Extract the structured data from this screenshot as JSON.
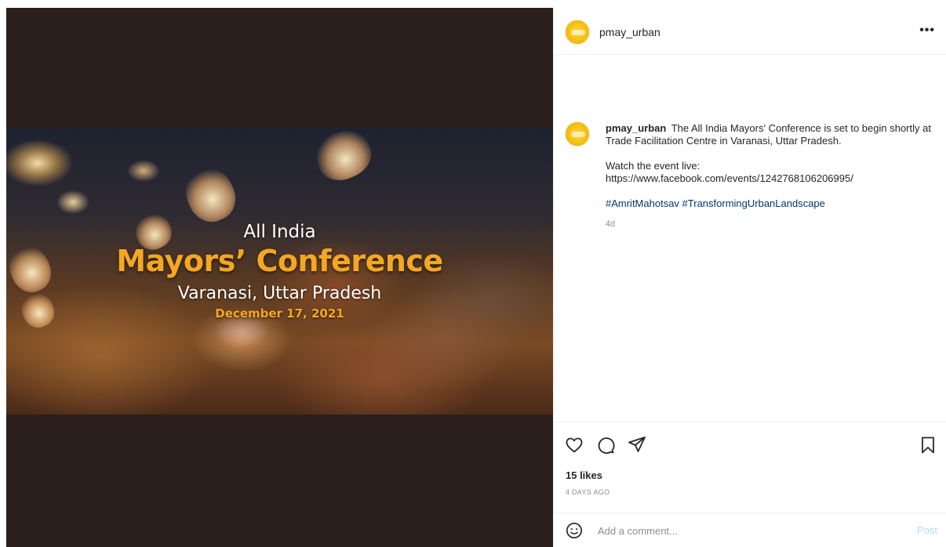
{
  "media": {
    "line1": "All India",
    "line2": "Mayors’ Conference",
    "line3": "Varanasi, Uttar Pradesh",
    "line4": "December 17, 2021",
    "colors": {
      "accent": "#f5a623",
      "text": "#ffffff",
      "background": "#2a1f1b"
    }
  },
  "header": {
    "username": "pmay_urban",
    "more_label": "•••"
  },
  "caption": {
    "username": "pmay_urban",
    "text": "The All India Mayors' Conference is set to begin shortly at Trade Facilitation Centre in Varanasi, Uttar Pradesh.",
    "watch_label": "Watch the event live:",
    "link": "https://www.facebook.com/events/1242768106206995/",
    "hashtags": [
      "#AmritMahotsav",
      "#TransformingUrbanLandscape"
    ],
    "time": "4d"
  },
  "actions": {
    "icons": [
      "heart-icon",
      "comment-icon",
      "share-icon",
      "bookmark-icon"
    ]
  },
  "stats": {
    "likes": "15 likes",
    "posted_ago": "4 DAYS AGO"
  },
  "comment": {
    "placeholder": "Add a comment...",
    "post_label": "Post",
    "emoji_icon": "smiley-icon"
  }
}
